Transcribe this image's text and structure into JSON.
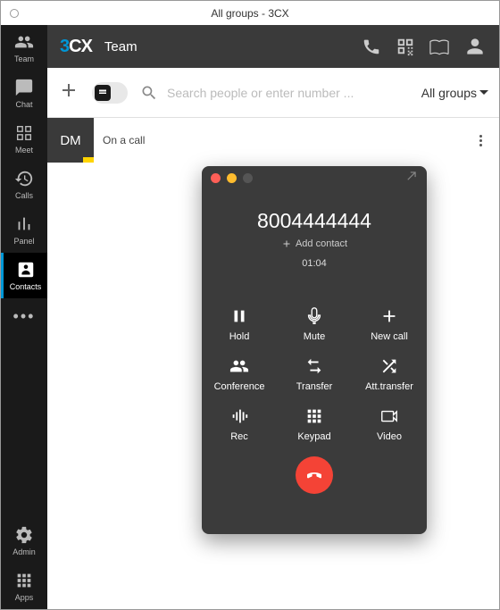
{
  "window": {
    "title": "All groups - 3CX"
  },
  "topbar": {
    "title": "Team"
  },
  "sidebar": {
    "items": [
      {
        "label": "Team"
      },
      {
        "label": "Chat"
      },
      {
        "label": "Meet"
      },
      {
        "label": "Calls"
      },
      {
        "label": "Panel"
      },
      {
        "label": "Contacts"
      }
    ],
    "admin": "Admin",
    "apps": "Apps"
  },
  "toolbar": {
    "search_placeholder": "Search people or enter number ...",
    "group_filter": "All groups"
  },
  "contact": {
    "initials": "DM",
    "status": "On a call"
  },
  "call": {
    "number": "8004444444",
    "add_contact": "Add contact",
    "timer": "01:04",
    "buttons": {
      "hold": "Hold",
      "mute": "Mute",
      "newcall": "New call",
      "conference": "Conference",
      "transfer": "Transfer",
      "att_transfer": "Att.transfer",
      "rec": "Rec",
      "keypad": "Keypad",
      "video": "Video"
    }
  }
}
